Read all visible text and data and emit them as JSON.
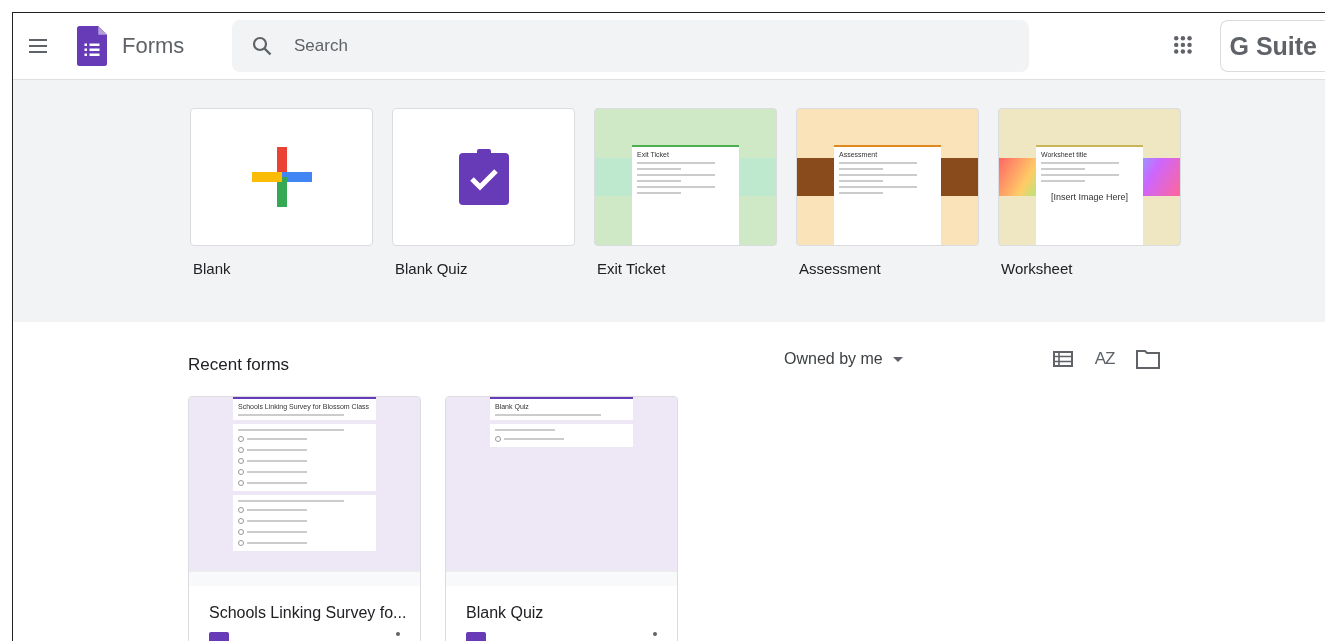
{
  "header": {
    "app_name": "Forms",
    "search": {
      "placeholder": "Search"
    },
    "brand_button": "G Suite"
  },
  "templates": [
    {
      "label": "Blank",
      "kind": "blank"
    },
    {
      "label": "Blank Quiz",
      "kind": "quiz"
    },
    {
      "label": "Exit Ticket",
      "kind": "hikers",
      "preview": {
        "title": "Exit Ticket"
      }
    },
    {
      "label": "Assessment",
      "kind": "desk",
      "preview": {
        "title": "Assessment"
      }
    },
    {
      "label": "Worksheet",
      "kind": "mosaic",
      "preview": {
        "title": "Worksheet title",
        "image_text": "[Insert Image Here]"
      }
    }
  ],
  "recent": {
    "title": "Recent forms",
    "owner_filter": "Owned by me",
    "sort_label": "AZ",
    "forms": [
      {
        "title": "Schools Linking Survey fo...",
        "preview_title": "Schools Linking Survey for Blossom Class",
        "kind": "survey"
      },
      {
        "title": "Blank Quiz",
        "preview_title": "Blank Quiz",
        "kind": "quiz"
      }
    ]
  }
}
